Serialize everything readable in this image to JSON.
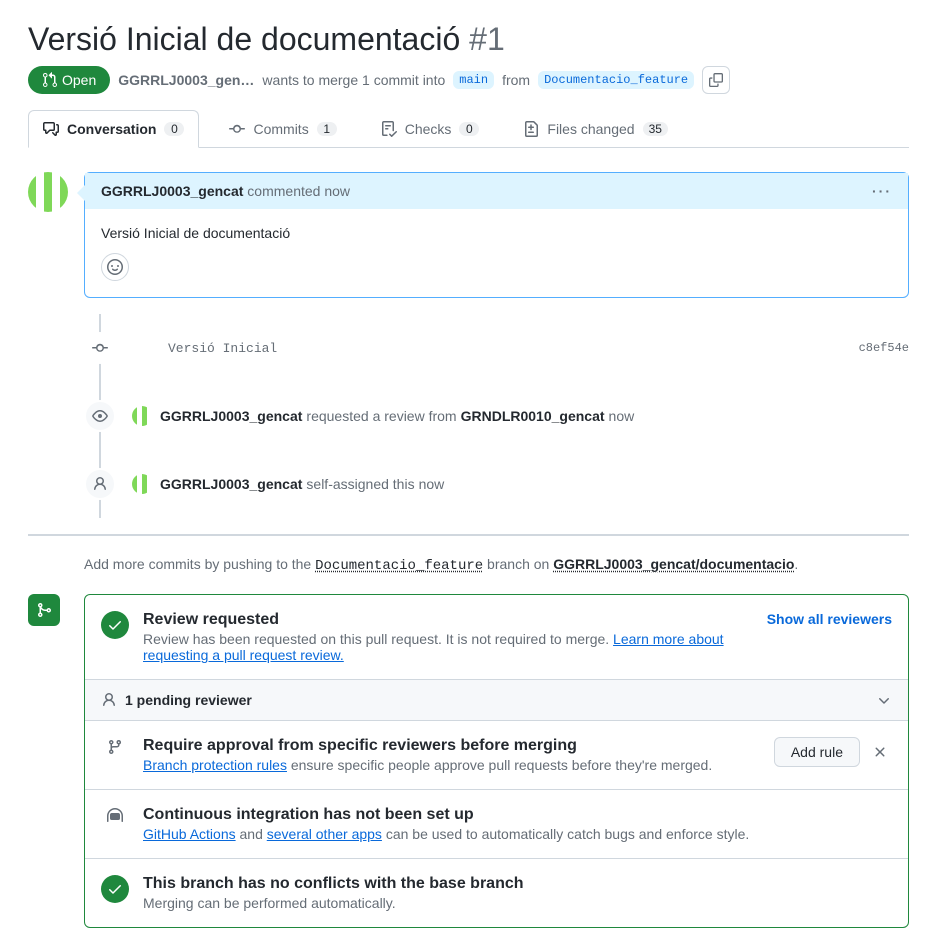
{
  "header": {
    "title": "Versió Inicial de documentació",
    "number": "#1",
    "state": "Open",
    "author_truncated": "GGRRLJ0003_gen…",
    "merge_text_1": "wants to merge 1 commit into",
    "base_branch": "main",
    "merge_text_2": "from",
    "head_branch": "Documentacio_feature"
  },
  "tabs": {
    "conversation": {
      "label": "Conversation",
      "count": "0"
    },
    "commits": {
      "label": "Commits",
      "count": "1"
    },
    "checks": {
      "label": "Checks",
      "count": "0"
    },
    "files": {
      "label": "Files changed",
      "count": "35"
    }
  },
  "comment": {
    "author": "GGRRLJ0003_gencat",
    "action": "commented",
    "time": "now",
    "body": "Versió Inicial de documentació"
  },
  "timeline": {
    "commit": {
      "message": "Versió Inicial",
      "sha": "c8ef54e"
    },
    "review_req": {
      "actor": "GGRRLJ0003_gencat",
      "text1": "requested a review from",
      "reviewer": "GRNDLR0010_gencat",
      "time": "now"
    },
    "self_assign": {
      "actor": "GGRRLJ0003_gencat",
      "text": "self-assigned this",
      "time": "now"
    }
  },
  "push_hint": {
    "prefix": "Add more commits by pushing to the",
    "branch": "Documentacio_feature",
    "mid": "branch on",
    "repo": "GGRRLJ0003_gencat/documentacio"
  },
  "merge": {
    "review": {
      "title": "Review requested",
      "desc": "Review has been requested on this pull request. It is not required to merge.",
      "learn": "Learn more about requesting a pull request review.",
      "show_all": "Show all reviewers"
    },
    "pending": "1 pending reviewer",
    "protect": {
      "title": "Require approval from specific reviewers before merging",
      "link": "Branch protection rules",
      "rest": "ensure specific people approve pull requests before they're merged.",
      "button": "Add rule"
    },
    "ci": {
      "title": "Continuous integration has not been set up",
      "link1": "GitHub Actions",
      "mid": "and",
      "link2": "several other apps",
      "rest": "can be used to automatically catch bugs and enforce style."
    },
    "conflicts": {
      "title": "This branch has no conflicts with the base branch",
      "desc": "Merging can be performed automatically."
    }
  }
}
